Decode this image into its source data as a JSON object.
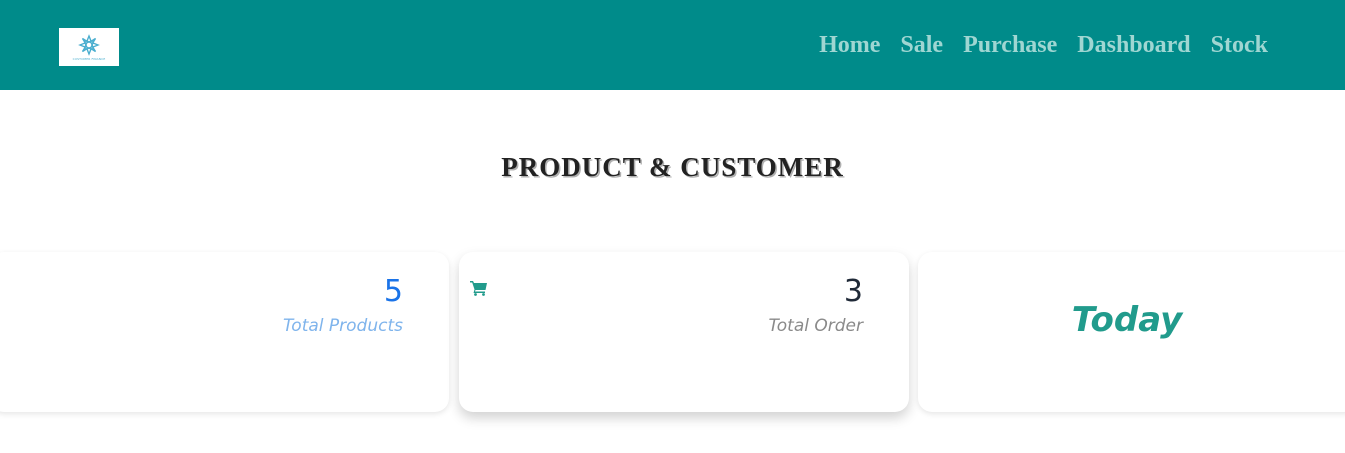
{
  "navbar": {
    "logo_text": "CUSTOMER FINANCE",
    "links": [
      {
        "label": "Home"
      },
      {
        "label": "Sale"
      },
      {
        "label": "Purchase"
      },
      {
        "label": "Dashboard"
      },
      {
        "label": "Stock"
      }
    ],
    "bg_color": "#008b8a",
    "link_color": "#9fd6d2"
  },
  "page": {
    "title": "PRODUCT & CUSTOMER"
  },
  "cards": [
    {
      "value": "5",
      "label": "Total Products",
      "value_color": "#1a73e8"
    },
    {
      "value": "3",
      "label": "Total Order",
      "icon": "shopping-cart-icon",
      "icon_color": "#219b8c"
    },
    {
      "label": "Today",
      "color": "#219b8c"
    }
  ]
}
